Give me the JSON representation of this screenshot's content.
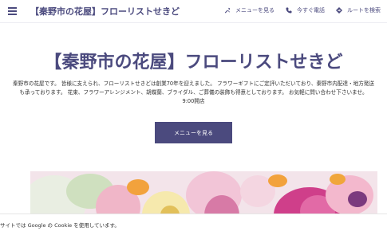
{
  "header": {
    "site_title": "【秦野市の花屋】フローリストせきど",
    "nav": [
      {
        "label": "メニューを見る",
        "icon": "tools-icon"
      },
      {
        "label": "今すぐ電話",
        "icon": "phone-icon"
      },
      {
        "label": "ルートを検索",
        "icon": "directions-icon"
      }
    ]
  },
  "hero": {
    "title": "【秦野市の花屋】フローリストせきど",
    "description": "秦野市の花屋です。 皆様に支えられ、フローリストせきどは創業70年を迎えました。 フラワーギフトにご定評いただいており、秦野市内配達・地方発送も承っております。 花束、フラワーアレンジメント、胡蝶蘭、ブライダル、ご葬儀の装飾も得意としております。 お気軽に問い合わせ下さいませ。",
    "open_time": "9:00開店",
    "cta_label": "メニューを見る"
  },
  "cookie": {
    "text": "サイトでは Google の Cookie を使用しています。"
  },
  "colors": {
    "brand": "#4b4a7e",
    "background": "#ffffff"
  }
}
